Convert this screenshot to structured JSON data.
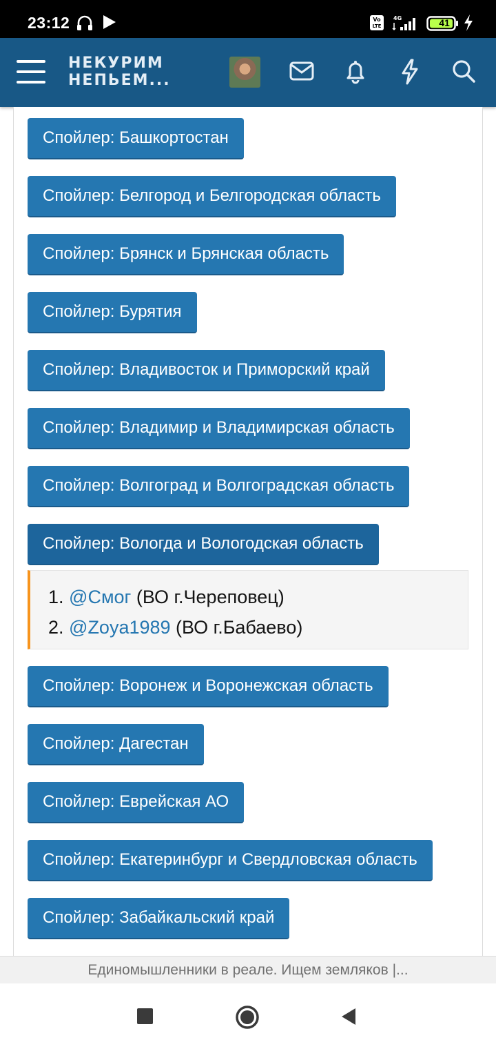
{
  "status_bar": {
    "time": "23:12",
    "network_volte": "Vo LTE",
    "network_type": "4G",
    "battery_level": "41",
    "icons": [
      "headphones-icon",
      "play-icon",
      "volte-icon",
      "signal-icon",
      "battery-icon",
      "charging-icon"
    ]
  },
  "header": {
    "logo_line1": "НЕКУРИМ",
    "logo_line2": "НЕПЬЕМ...",
    "icons": [
      "menu-icon",
      "avatar",
      "mail-icon",
      "bell-icon",
      "bolt-icon",
      "search-icon"
    ],
    "brand_color": "#185886"
  },
  "spoilers": [
    {
      "label": "Спойлер: Башкортостан"
    },
    {
      "label": "Спойлер: Белгород и Белгородская область"
    },
    {
      "label": "Спойлер: Брянск и Брянская область"
    },
    {
      "label": "Спойлер: Бурятия"
    },
    {
      "label": "Спойлер: Владивосток и Приморский край"
    },
    {
      "label": "Спойлер: Владимир и Владимирская область"
    },
    {
      "label": "Спойлер: Волгоград и Волгоградская область"
    },
    {
      "label": "Спойлер: Вологда и Вологодская область",
      "expanded": true
    },
    {
      "label": "Спойлер: Воронеж и Воронежская область"
    },
    {
      "label": "Спойлер: Дагестан"
    },
    {
      "label": "Спойлер: Еврейская АО"
    },
    {
      "label": "Спойлер: Екатеринбург и Свердловская область"
    },
    {
      "label": "Спойлер: Забайкальский край"
    }
  ],
  "vologda_list": [
    {
      "num": "1. ",
      "mention": "@Смог",
      "note": " (ВО г.Череповец)"
    },
    {
      "num": "2. ",
      "mention": "@Zoya1989",
      "note": " (ВО г.Бабаево)"
    }
  ],
  "colors": {
    "spoiler_button": "#2577b1",
    "accent_border": "#f7941d",
    "mention": "#2577b1"
  },
  "url_bar": {
    "title": "Единомышленники в реале. Ищем земляков |..."
  },
  "nav_bar": {
    "icons": [
      "recents-icon",
      "home-icon",
      "back-icon"
    ]
  }
}
